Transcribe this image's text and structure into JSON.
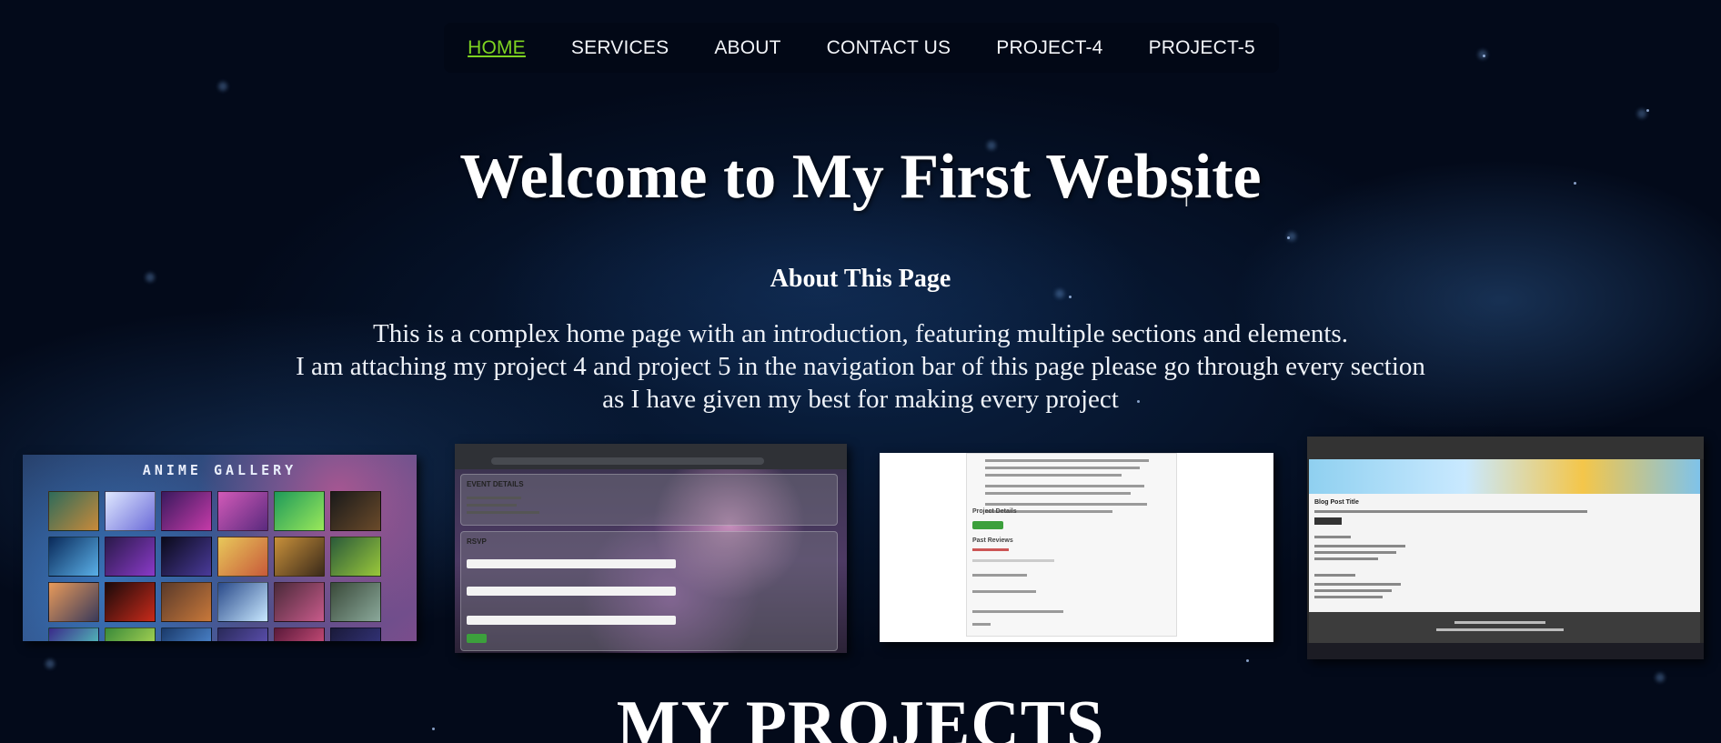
{
  "nav": {
    "items": [
      {
        "label": "HOME",
        "active": true
      },
      {
        "label": "SERVICES",
        "active": false
      },
      {
        "label": "ABOUT",
        "active": false
      },
      {
        "label": "CONTACT US",
        "active": false
      },
      {
        "label": "PROJECT-4",
        "active": false
      },
      {
        "label": "PROJECT-5",
        "active": false
      }
    ],
    "active_color": "#7ed321",
    "text_color": "#f2f4f8"
  },
  "hero": {
    "title": "Welcome to My First Website"
  },
  "about": {
    "heading": "About This Page",
    "line1": "This is a complex home page with an introduction, featuring multiple sections and elements.",
    "line2": "I am attaching my project 4 and project 5 in the navigation bar of this page please go through every section as I have given my best for making every project"
  },
  "thumbnails": [
    {
      "name": "anime-gallery",
      "title": "ANIME GALLERY"
    },
    {
      "name": "event-details-rsvp",
      "card1_label": "EVENT DETAILS",
      "card2_label": "RSVP"
    },
    {
      "name": "project-details-doc",
      "label1": "Project Details",
      "label2": "Past Reviews"
    },
    {
      "name": "blog-post",
      "label": "Blog Post Title"
    }
  ],
  "projects": {
    "heading": "MY PROJECTS"
  }
}
